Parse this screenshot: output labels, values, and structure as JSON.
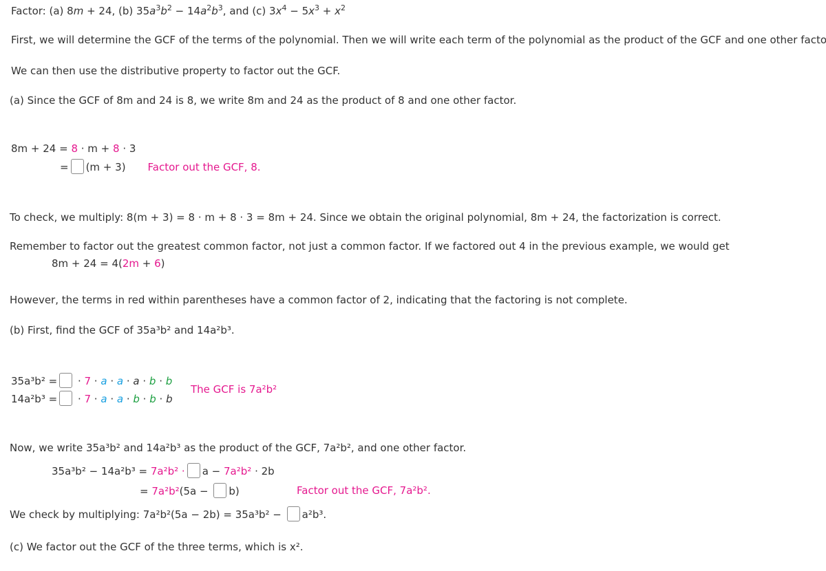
{
  "title": {
    "prefix": "Factor: (a) 8",
    "a_var": "m",
    "a_rest": " + 24, (b) 35",
    "b1": "a",
    "b1e": "3",
    "b2": "b",
    "b2e": "2",
    "b_mid": " − 14",
    "b3": "a",
    "b3e": "2",
    "b4": "b",
    "b4e": "3",
    "c_prefix": ", and (c) 3",
    "c1": "x",
    "c1e": "4",
    "c_mid": " − 5",
    "c2": "x",
    "c2e": "3",
    "c_plus": " + ",
    "c3": "x",
    "c3e": "2"
  },
  "intro1": "First, we will determine the GCF of the terms of the polynomial. Then we will write each term of the polynomial as the product of the GCF and one other factor.",
  "intro2": "We can then use the distributive property to factor out the GCF.",
  "part_a_intro": "(a) Since the GCF of 8m and 24 is 8, we write 8m and 24 as the product of 8 and one other factor.",
  "part_a": {
    "eq1_lhs": "8m + 24 = ",
    "eq1_8a": "8",
    "eq1_mid": " · m + ",
    "eq1_8b": "8",
    "eq1_end": " · 3",
    "eq2_eq": "=",
    "eq2_rest": "(m + 3)",
    "eq2_note": "Factor out the GCF, 8.",
    "answer_box_1": ""
  },
  "check_a": "To check, we multiply: 8(m + 3) = 8 · m + 8 · 3 = 8m + 24. Since we obtain the original polynomial, 8m + 24, the factorization is correct.",
  "remember": "Remember to factor out the greatest common factor, not just a common factor. If we factored out 4 in the previous example, we would get",
  "remember_eq": {
    "lhs": "8m + 24 = 4(",
    "red1": "2m",
    "plus": " + ",
    "red2": "6",
    "close": ")"
  },
  "however": "However, the terms in red within parentheses have a common factor of 2, indicating that the factoring is not complete.",
  "part_b_intro": "(b) First, find the GCF of 35a³b² and 14a²b³.",
  "part_b": {
    "row1_lhs": "35a³b² =",
    "row1_factors": [
      "7",
      "a",
      "a",
      "a",
      "b",
      "b"
    ],
    "row2_lhs": "14a²b³ =",
    "row2_factors": [
      "7",
      "a",
      "a",
      "b",
      "b",
      "b"
    ],
    "gcf_note": "The GCF is 7a²b²",
    "answer_box_2": "",
    "answer_box_3": ""
  },
  "now_write": "Now, we write 35a³b² and 14a²b³ as the product of the GCF, 7a²b², and one other factor.",
  "part_b_eq": {
    "lhs": "35a³b² − 14a²b³ = ",
    "gcf1": "7a²b² ·",
    "mid": "a − ",
    "gcf2": "7a²b²",
    "end": " · 2b",
    "eq2_eq": "= ",
    "eq2_gcf": "7a²b²",
    "eq2_open": "(5a − ",
    "eq2_close": "b)",
    "eq2_note": "Factor out the GCF, 7a²b².",
    "answer_box_4": "",
    "answer_box_5": ""
  },
  "check_b": {
    "prefix": "We check by multiplying: 7a²b²(5a − 2b) = 35a³b² − ",
    "suffix": "a²b³.",
    "answer_box_6": ""
  },
  "part_c_intro": "(c) We factor out the GCF of the three terms, which is x²."
}
